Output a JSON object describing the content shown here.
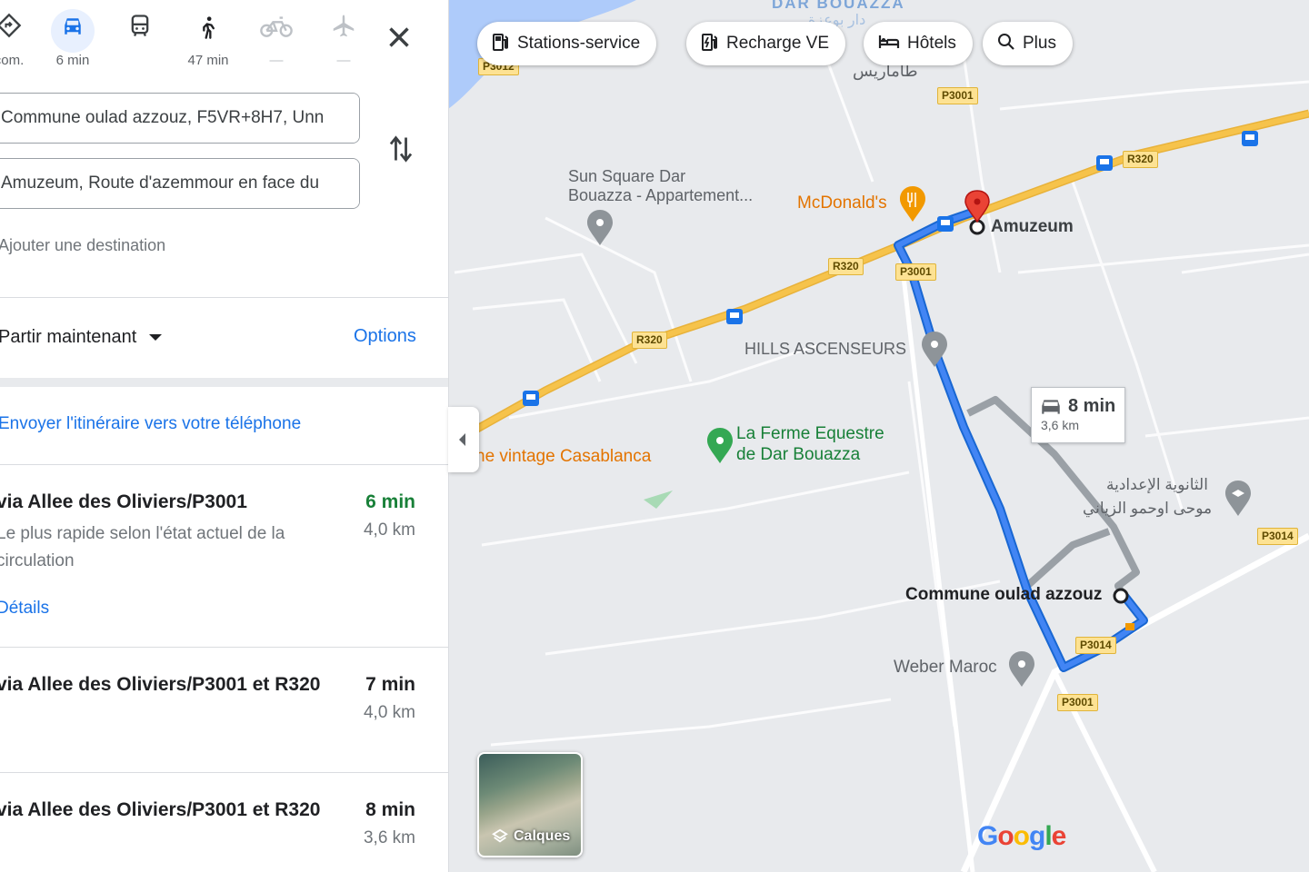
{
  "modes": [
    {
      "label": "com.",
      "icon": "best-route-icon"
    },
    {
      "label": "6 min",
      "icon": "car-icon"
    },
    {
      "label": "",
      "icon": "transit-icon"
    },
    {
      "label": "47 min",
      "icon": "walking-icon"
    },
    {
      "label": "—",
      "icon": "bicycle-icon"
    },
    {
      "label": "—",
      "icon": "airplane-icon"
    }
  ],
  "origin_value": "Commune oulad azzouz, F5VR+8H7, Unn",
  "destination_value": "Amuzeum, Route d'azemmour en face du",
  "add_destination": "Ajouter une destination",
  "depart": "Partir maintenant",
  "options": "Options",
  "send_to_phone": "Envoyer l'itinéraire vers votre téléphone",
  "routes": [
    {
      "name": "via Allee des Oliviers/P3001",
      "time": "6 min",
      "distance": "4,0 km",
      "desc": "Le plus rapide selon l'état actuel de la circulation",
      "details": "Détails",
      "time_color": "#188038"
    },
    {
      "name": "via Allee des Oliviers/P3001 et R320",
      "time": "7 min",
      "distance": "4,0 km"
    },
    {
      "name": "via Allee des Oliviers/P3001 et R320",
      "time": "8 min",
      "distance": "3,6 km"
    }
  ],
  "chips": [
    "Stations-service",
    "Recharge VE",
    "Hôtels",
    "Plus"
  ],
  "map": {
    "area_name": "DAR BOUAZZA",
    "area_arabic": "دار بوعزة",
    "tamaris_arabic": "طاماريس",
    "places": {
      "sun_square_1": "Sun Square Dar",
      "sun_square_2": "Bouazza - Appartement...",
      "mcdonalds": "McDonald's",
      "amuzeum": "Amuzeum",
      "hills": "HILLS ASCENSEURS",
      "ferme_1": "La Ferme Equestre",
      "ferme_2": "de Dar Bouazza",
      "vintage": "he vintage Casablanca",
      "school_1": "الثانوية الإعدادية",
      "school_2": "موحى اوحمو الزياني",
      "commune": "Commune oulad azzouz",
      "weber": "Weber Maroc"
    },
    "road_tags": [
      "P3012",
      "P3001",
      "R320",
      "R320",
      "R320",
      "P3001",
      "P3014",
      "P3014",
      "P3001"
    ],
    "alt_route_time": "8 min",
    "alt_route_distance": "3,6 km",
    "layers": "Calques",
    "google": "Google",
    "route_color": "#1a73e8",
    "alt_route_color": "#9aa0a6",
    "highway_color": "#f6c34b"
  }
}
